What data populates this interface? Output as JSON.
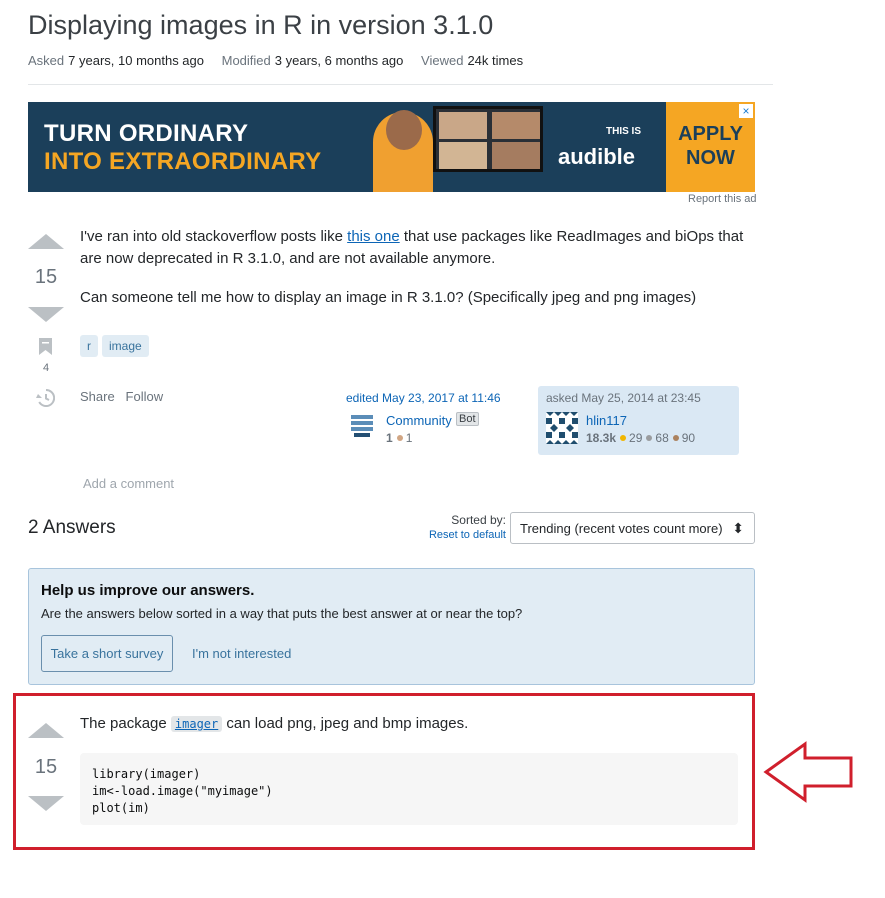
{
  "question": {
    "title": "Displaying images in R in version 3.1.0",
    "meta": [
      {
        "label": "Asked",
        "value": "7 years, 10 months ago"
      },
      {
        "label": "Modified",
        "value": "3 years, 6 months ago"
      },
      {
        "label": "Viewed",
        "value": "24k times"
      }
    ],
    "score": "15",
    "bookmark_count": "4",
    "body_p1_before": "I've ran into old stackoverflow posts like ",
    "body_p1_link": "this one",
    "body_p1_after": " that use packages like ReadImages and biOps that are now deprecated in R 3.1.0, and are not available anymore.",
    "body_p2": "Can someone tell me how to display an image in R 3.1.0? (Specifically jpeg and png images)",
    "tags": [
      "r",
      "image"
    ],
    "share_label": "Share",
    "follow_label": "Follow",
    "edited_label": "edited May 23, 2017 at 11:46",
    "editor_name": "Community",
    "editor_badge": "Bot",
    "editor_rep": "1",
    "editor_bronze": "1",
    "asked_label": "asked May 25, 2014 at 23:45",
    "asker_name": "hlin117",
    "asker_rep": "18.3k",
    "asker_gold": "29",
    "asker_silver": "68",
    "asker_bronze": "90",
    "add_comment": "Add a comment"
  },
  "ad": {
    "line1": "TURN ORDINARY",
    "line2": "INTO EXTRAORDINARY",
    "this_is": "THIS IS",
    "brand": "audible",
    "cta_line1": "APPLY",
    "cta_line2": "NOW",
    "report": "Report this ad",
    "close_icon": "×"
  },
  "answers": {
    "count_label": "2 Answers",
    "sorted_by": "Sorted by:",
    "reset": "Reset to default",
    "sort_value": "Trending (recent votes count more)",
    "sort_arrows": "⬍"
  },
  "survey": {
    "title": "Help us improve our answers.",
    "question": "Are the answers below sorted in a way that puts the best answer at or near the top?",
    "take_survey": "Take a short survey",
    "not_interested": "I'm not interested"
  },
  "answer1": {
    "score": "15",
    "text_before": "The package ",
    "package": "imager",
    "text_after": " can load png, jpeg and bmp images.",
    "code": "library(imager)\nim<-load.image(\"myimage\")\nplot(im)"
  },
  "colors": {
    "highlight_box": "#d01f2c",
    "link": "#0c65b6",
    "tag_bg": "#e1ecf4",
    "ad_bg": "#1b3f5a",
    "ad_accent": "#f5a623"
  }
}
